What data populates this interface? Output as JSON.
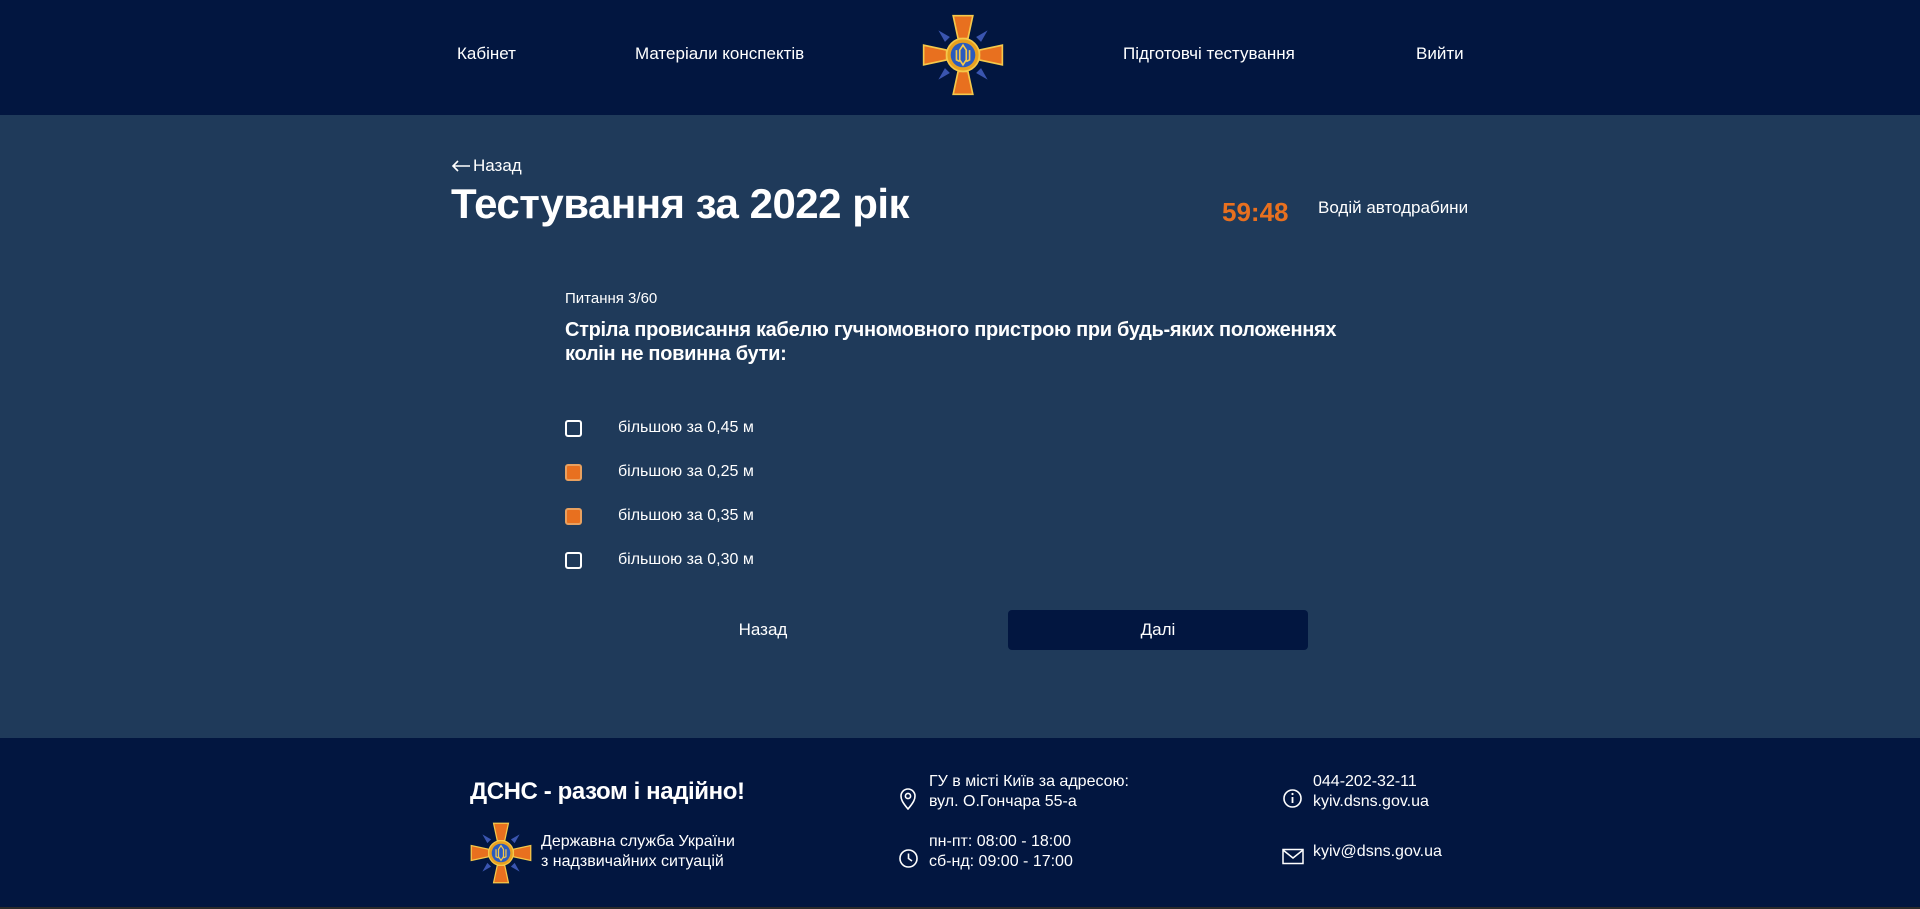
{
  "header": {
    "nav": {
      "cabinet": "Кабінет",
      "materials": "Матеріали конспектів",
      "prep_tests": "Підготовчі тестування",
      "logout": "Вийти"
    }
  },
  "main": {
    "back_link": "Назад",
    "title": "Тестування за 2022 рік",
    "timer": "59:48",
    "profession": "Водій автодрабини",
    "question": {
      "counter": "Питання 3/60",
      "text": "Стріла провисання кабелю гучномовного пристрою при будь-яких положеннях колін не повинна бути:",
      "answers": [
        {
          "label": "більшою за 0,45 м",
          "checked": false
        },
        {
          "label": "більшою за 0,25 м",
          "checked": true
        },
        {
          "label": "більшою за 0,35 м",
          "checked": true
        },
        {
          "label": "більшою за 0,30 м",
          "checked": false
        }
      ]
    },
    "buttons": {
      "back": "Назад",
      "next": "Далі"
    }
  },
  "footer": {
    "slogan": "ДСНС - разом і надійно!",
    "org_line1": "Державна служба України",
    "org_line2": "з надзвичайних ситуацій",
    "address_line1": "ГУ в місті Київ за адресою:",
    "address_line2": "вул. О.Гончара 55-а",
    "hours_line1": "пн-пт: 08:00 - 18:00",
    "hours_line2": "сб-нд: 09:00 - 17:00",
    "phone": "044-202-32-11",
    "website": "kyiv.dsns.gov.ua",
    "email": "kyiv@dsns.gov.ua"
  },
  "colors": {
    "header_bg": "#021640",
    "main_bg": "#1f3a5a",
    "accent_orange": "#e8701f",
    "text": "#ffffff"
  },
  "icons": {
    "logo": "dsns-emblem-icon",
    "back": "arrow-left-icon",
    "address": "location-pin-icon",
    "hours": "clock-icon",
    "info": "info-icon",
    "email": "envelope-icon"
  }
}
